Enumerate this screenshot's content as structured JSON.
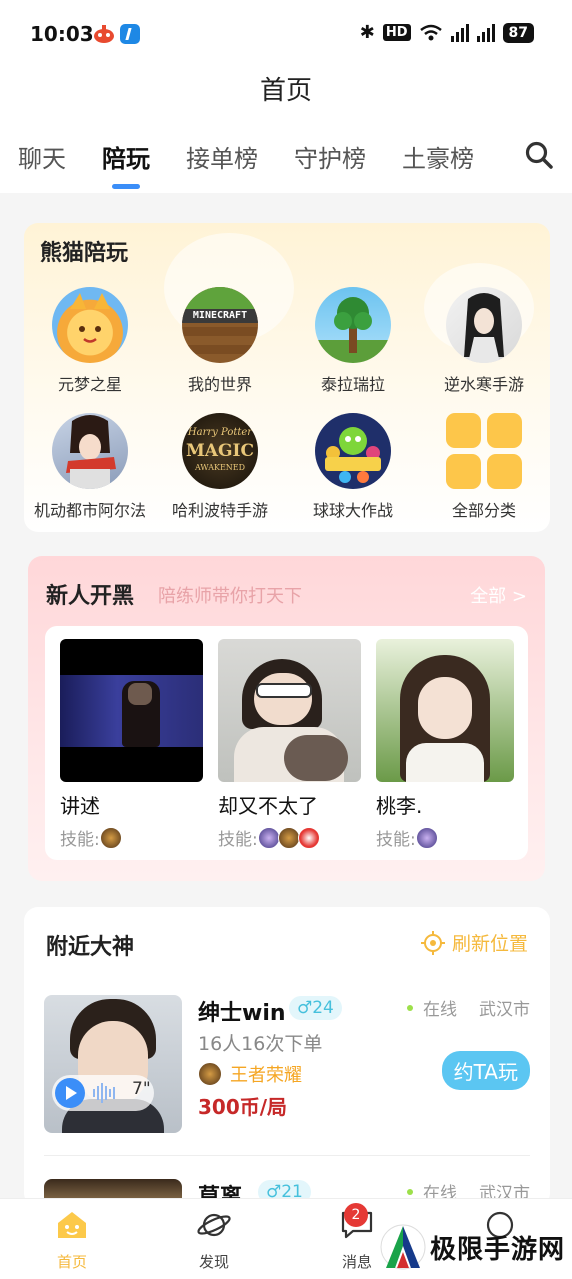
{
  "status_bar": {
    "time": "10:03",
    "hd": "HD",
    "battery": "87"
  },
  "header": {
    "title": "首页",
    "tabs": [
      "聊天",
      "陪玩",
      "接单榜",
      "守护榜",
      "土豪榜"
    ],
    "active_tab": "陪玩"
  },
  "games": {
    "title": "熊猫陪玩",
    "items": [
      {
        "name": "元梦之星",
        "icon": "yuanmeng-game-icon"
      },
      {
        "name": "我的世界",
        "icon": "minecraft-game-icon"
      },
      {
        "name": "泰拉瑞拉",
        "icon": "terraria-game-icon"
      },
      {
        "name": "逆水寒手游",
        "icon": "nishuihan-game-icon"
      },
      {
        "name": "机动都市阿尔法",
        "icon": "mecha-game-icon"
      },
      {
        "name": "哈利波特手游",
        "icon": "harry-potter-game-icon"
      },
      {
        "name": "球球大作战",
        "icon": "ball-battle-game-icon"
      },
      {
        "name": "全部分类",
        "icon": "all-categories-icon"
      }
    ]
  },
  "newbie": {
    "title": "新人开黑",
    "subtitle": "陪练师带你打天下",
    "more": "全部 >",
    "players": [
      {
        "name": "讲述",
        "skills_label": "技能:"
      },
      {
        "name": "却又不太了",
        "skills_label": "技能:"
      },
      {
        "name": "桃李.",
        "skills_label": "技能:"
      }
    ]
  },
  "nearby": {
    "title": "附近大神",
    "refresh_label": "刷新位置",
    "people": [
      {
        "name": "绅士win",
        "gender_age": "♂24",
        "status": "在线",
        "city": "武汉市",
        "orders": "16人16次下单",
        "game": "王者荣耀",
        "price": "300币/局",
        "voice_duration": "7\"",
        "button": "约TA玩"
      },
      {
        "name": "莫离",
        "gender_age": "♂21",
        "status": "在线",
        "city": "武汉市"
      }
    ]
  },
  "tabbar": {
    "items": [
      "首页",
      "发现",
      "消息",
      "我的"
    ],
    "active": "首页",
    "message_badge": "2"
  },
  "watermark": {
    "text": "极限手游网"
  },
  "colors": {
    "accent": "#3b8ef8",
    "gold": "#f5b93d",
    "price": "#c62828",
    "cyan": "#5bc6f2"
  }
}
